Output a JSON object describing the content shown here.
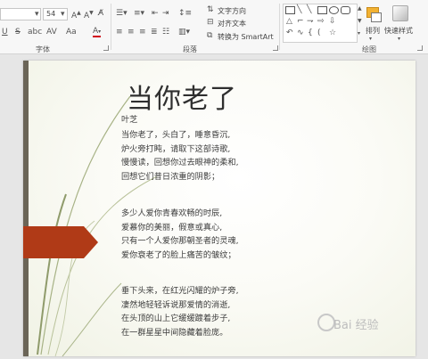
{
  "ribbon": {
    "font_size": "54",
    "font_group_label": "字体",
    "paragraph_group_label": "段落",
    "drawing_group_label": "绘图",
    "text_direction_label": "文字方向",
    "align_text_label": "对齐文本",
    "smartart_label": "转换为 SmartArt",
    "arrange_label": "排列",
    "quick_styles_label": "快速样式"
  },
  "slide": {
    "title": "当你老了",
    "author": "叶芝",
    "stanzas": [
      [
        "当你老了，头白了，睡意昏沉,",
        "炉火旁打盹，请取下这部诗歌,",
        "慢慢读，回想你过去眼神的柔和,",
        "回想它们昔日浓重的阴影；"
      ],
      [
        "多少人爱你青春欢畅的时辰,",
        "爱慕你的美丽，假意或真心,",
        "只有一个人爱你那朝圣者的灵魂,",
        "爱你衰老了的脸上痛苦的皱纹；"
      ],
      [
        "垂下头来，在红光闪耀的炉子旁,",
        "凄然地轻轻诉说那爱情的消逝,",
        "在头顶的山上它缓缓踱着步子,",
        "在一群星星中间隐藏着脸庞。"
      ]
    ]
  },
  "watermark": "Bai 经验",
  "colors": {
    "accent_arrow": "#b03a17",
    "left_bar": "#6b6557",
    "swoosh": "#9aa67a"
  }
}
